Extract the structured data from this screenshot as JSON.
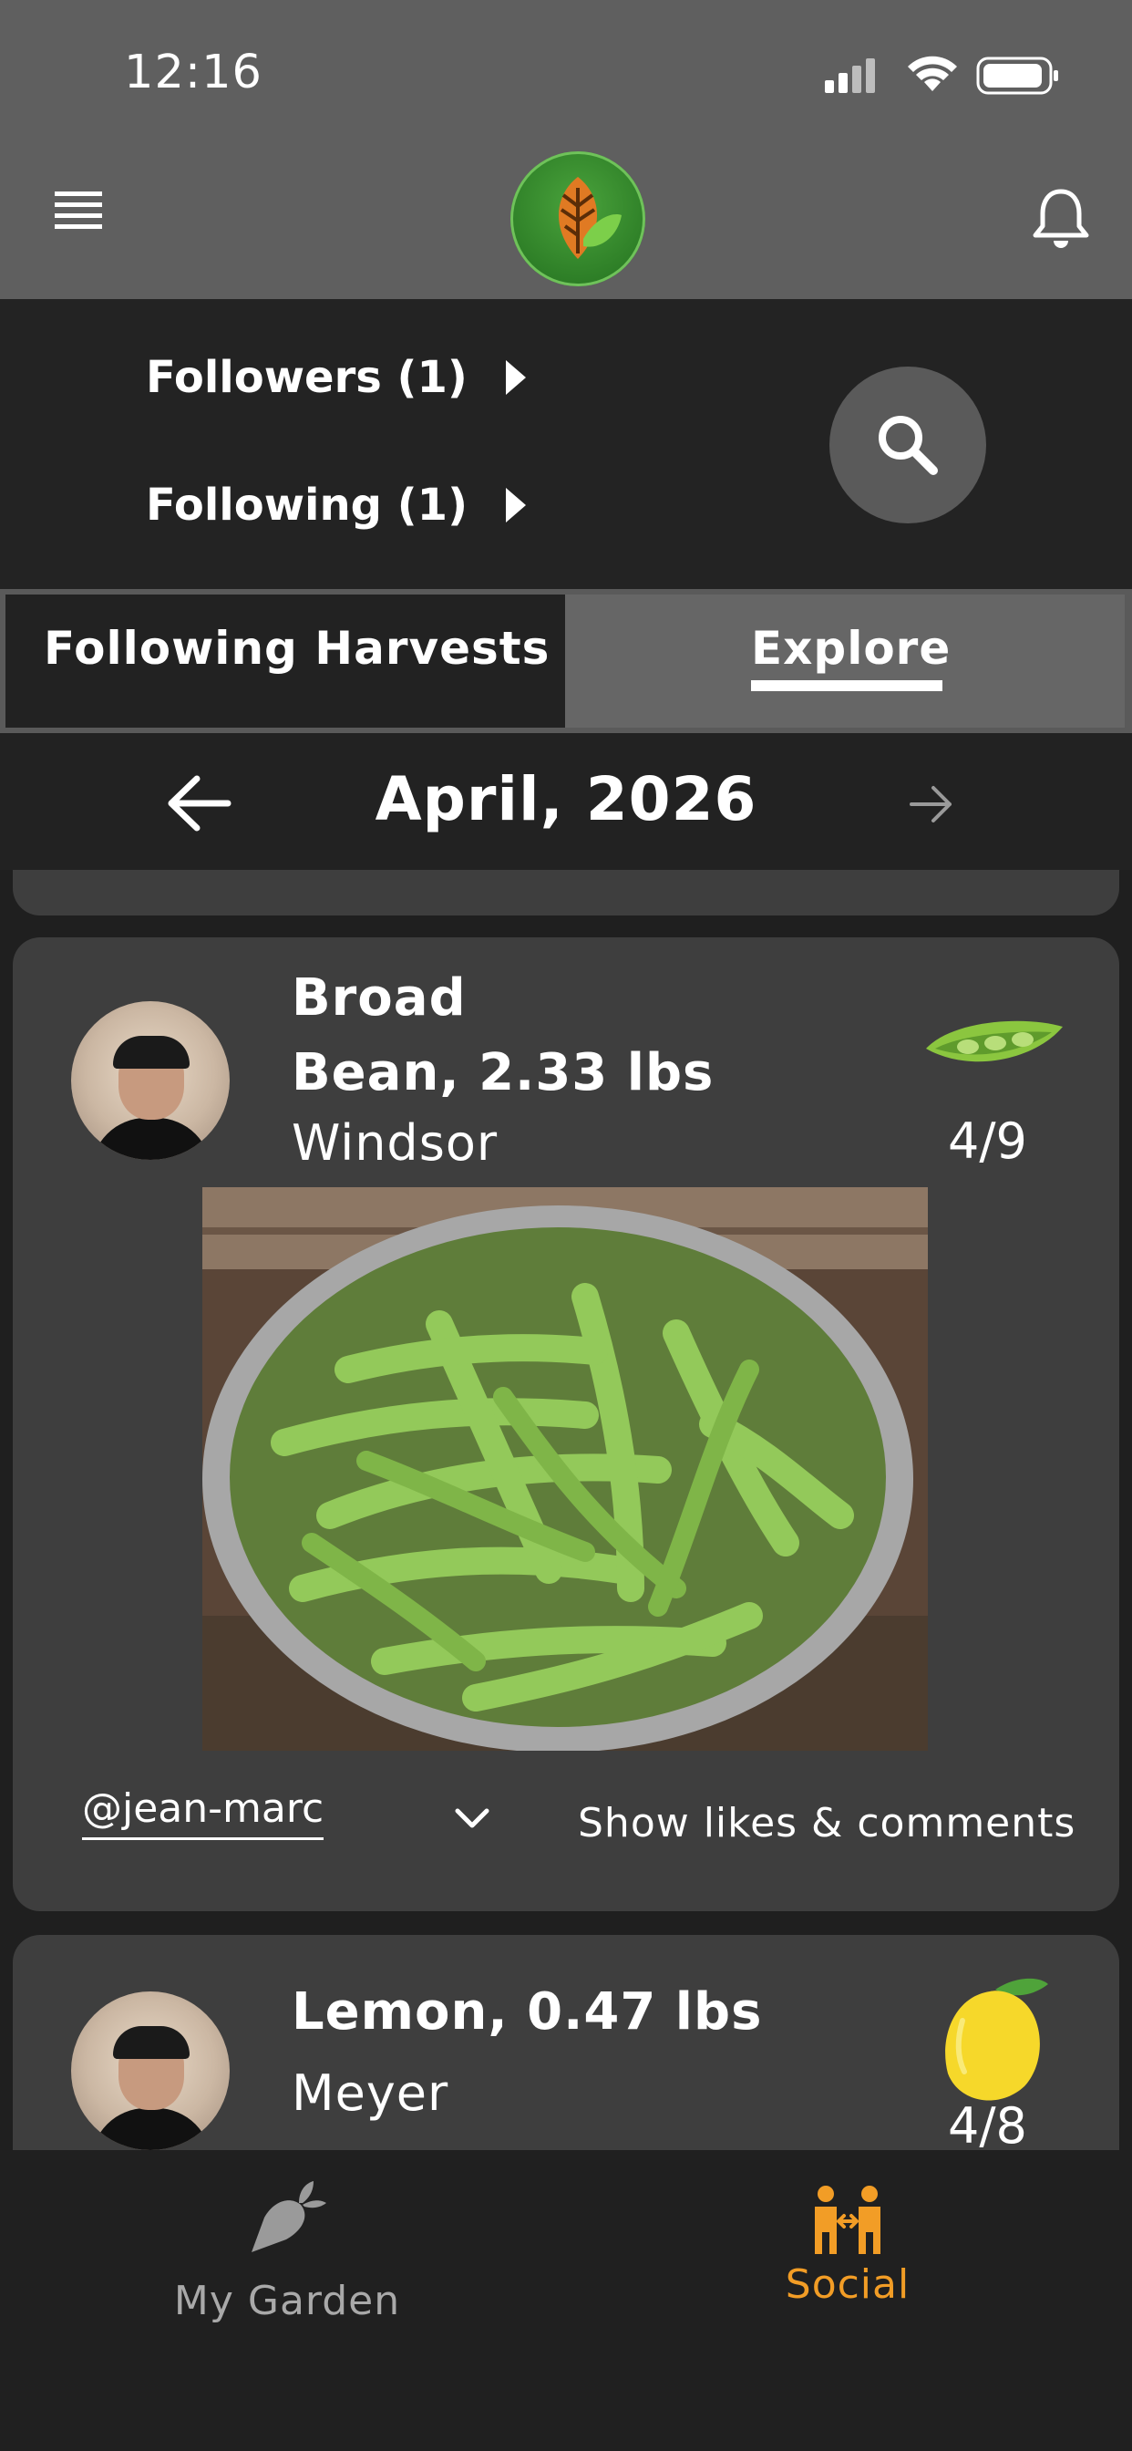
{
  "status_bar": {
    "time": "12:16"
  },
  "header": {
    "logo": "leaf-logo",
    "menu_icon": "menu-icon",
    "bell_icon": "bell-icon"
  },
  "follow": {
    "followers_label": "Followers (1)",
    "following_label": "Following (1)",
    "search_icon": "search-icon"
  },
  "tabs": [
    {
      "label": "Following Harvests",
      "active": false
    },
    {
      "label": "Explore",
      "active": true
    }
  ],
  "month_nav": {
    "label": "April, 2026"
  },
  "feed": [
    {
      "crop_line1": "Broad",
      "crop_line2": "Bean, 2.33 lbs",
      "variety": "Windsor",
      "date": "4/9",
      "icon": "broad-bean-icon",
      "username": "@jean-marc",
      "likes_label": "Show likes & comments"
    },
    {
      "crop_line1": "Lemon, 0.47 lbs",
      "variety": "Meyer",
      "date": "4/8",
      "icon": "lemon-icon"
    }
  ],
  "bottom_nav": [
    {
      "label": "My Garden",
      "icon": "carrot-icon",
      "active": false
    },
    {
      "label": "Social",
      "icon": "people-icon",
      "active": true
    }
  ],
  "colors": {
    "accent": "#f29d26",
    "header_bg": "#5f5f5f",
    "card_bg": "#3e3e3e"
  }
}
